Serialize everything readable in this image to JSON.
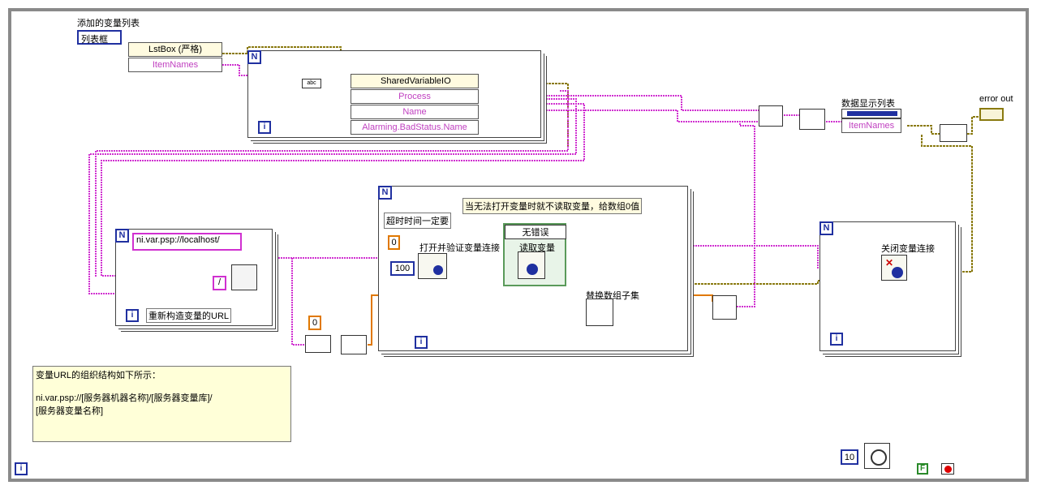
{
  "labels": {
    "added_var_list": "添加的变量列表",
    "listbox_ref": "列表框",
    "lstbox_node": "LstBox (严格)",
    "itemnames": "ItemNames",
    "shared_var_io": "SharedVariableIO",
    "process": "Process",
    "name": "Name",
    "alarming": "Alarming.BadStatus.Name",
    "url_const": "ni.var.psp://localhost/",
    "slash": "/",
    "rebuild_url": "重新构造变量的URL",
    "timeout_must": "超时时间一定要",
    "no_open_comment": "当无法打开变量时就不读取变量，给数组0值",
    "no_error": "无错误",
    "open_verify": "打开并验证变量连接",
    "read_var": "读取变量",
    "replace_subset": "替换数组子集",
    "const_0a": "0",
    "const_100": "100",
    "const_0b": "0",
    "data_display_list": "数据显示列表",
    "itemnames2": "ItemNames",
    "error_out": "error out",
    "close_conn": "关闭变量连接",
    "const_10": "10",
    "url_comment": "变量URL的组织结构如下所示：\n\nni.var.psp://[服务器机器名称]/[服务器变量库]/\n[服务器变量名称]",
    "stop_f": "F"
  },
  "colors": {
    "wire_pink": "#d030d0",
    "wire_cluster": "#8a7a10",
    "wire_orange": "#e07800",
    "wire_blue": "#1a2a80",
    "frame": "#8a8a8a"
  }
}
